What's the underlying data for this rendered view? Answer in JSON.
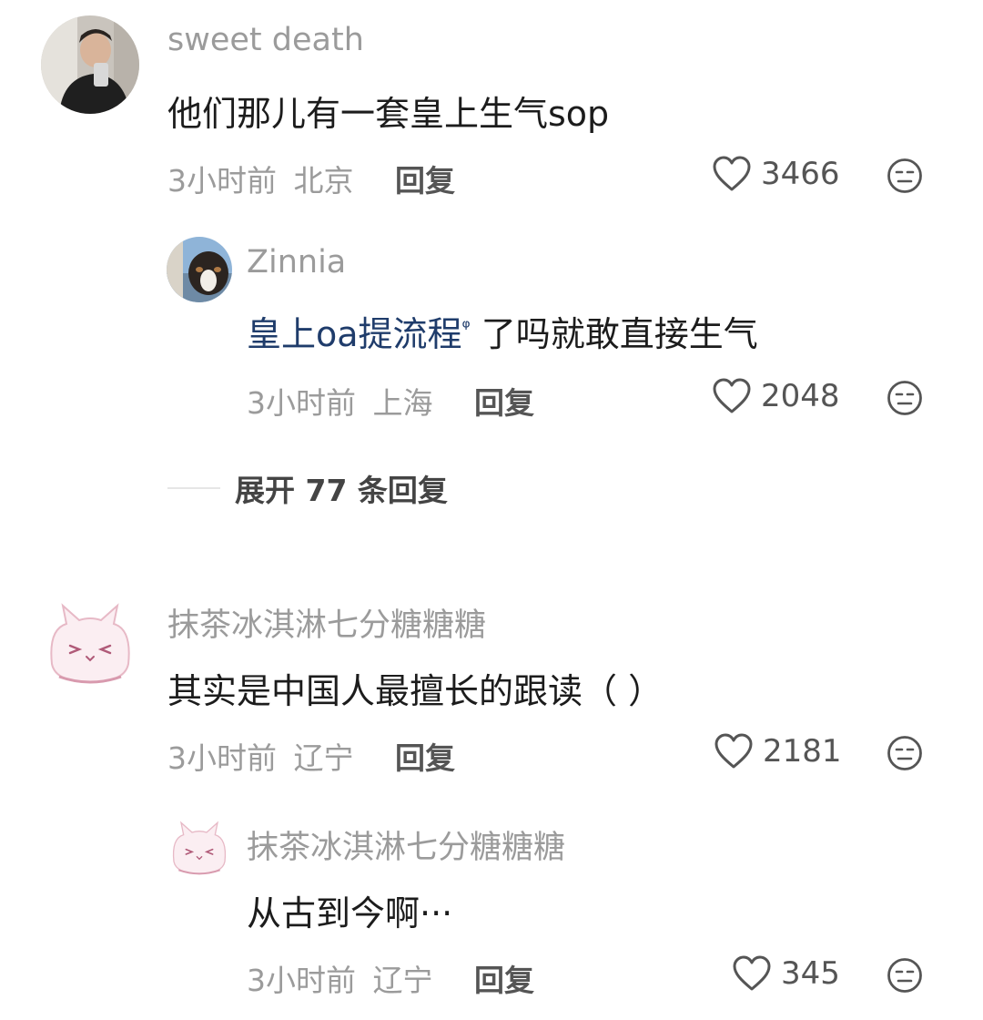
{
  "comments": [
    {
      "username": "sweet death",
      "text": "他们那儿有一套皇上生气sop",
      "time": "3小时前",
      "location": "北京",
      "reply_label": "回复",
      "likes": "3466",
      "replies": [
        {
          "username": "Zinnia",
          "text_link": "皇上oa提流程",
          "search_mark": "ᵠ",
          "text_rest": " 了吗就敢直接生气",
          "time": "3小时前",
          "location": "上海",
          "reply_label": "回复",
          "likes": "2048"
        }
      ],
      "expand_label": "展开 77 条回复"
    },
    {
      "username": "抹茶冰淇淋七分糖糖糖",
      "text": "其实是中国人最擅长的跟读（ ）",
      "time": "3小时前",
      "location": "辽宁",
      "reply_label": "回复",
      "likes": "2181",
      "replies": [
        {
          "username": "抹茶冰淇淋七分糖糖糖",
          "text": "从古到今啊···",
          "time": "3小时前",
          "location": "辽宁",
          "reply_label": "回复",
          "likes": "345"
        }
      ]
    }
  ],
  "icons": {
    "like": "heart-outline-icon",
    "dislike": "unamused-face-icon"
  },
  "colors": {
    "username": "#9b9b9b",
    "link": "#1f3c6b",
    "meta": "#9b9b9b"
  }
}
